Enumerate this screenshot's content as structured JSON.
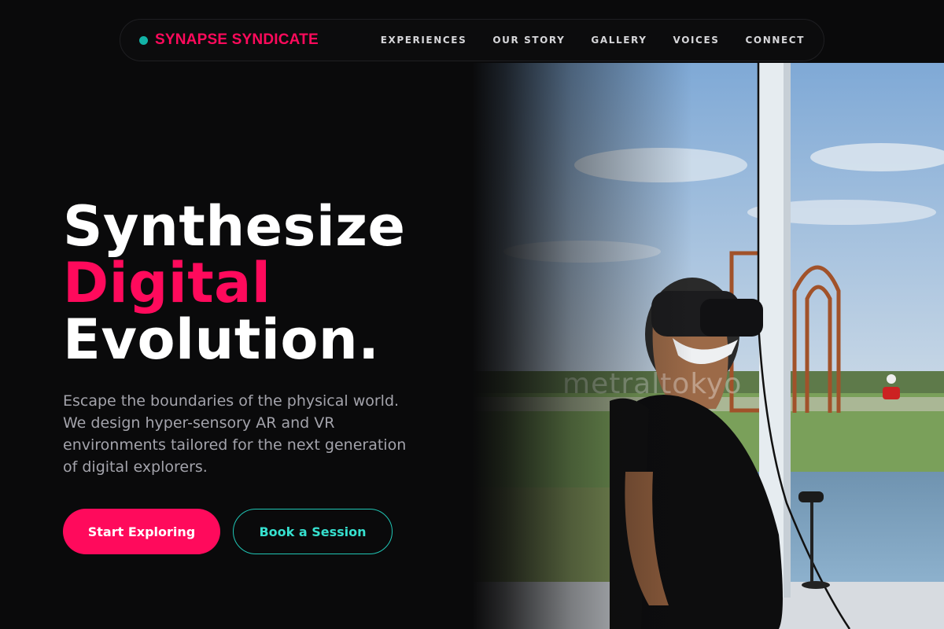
{
  "brand": {
    "name": "SYNAPSE SYNDICATE",
    "dot_color": "#12b3a6",
    "accent_color": "#ff0a5c"
  },
  "nav": {
    "items": [
      {
        "label": "EXPERIENCES"
      },
      {
        "label": "OUR STORY"
      },
      {
        "label": "GALLERY"
      },
      {
        "label": "VOICES"
      },
      {
        "label": "CONNECT"
      }
    ]
  },
  "hero": {
    "headline_line1": "Synthesize",
    "headline_line2": "Digital",
    "headline_line3": "Evolution.",
    "subtext": "Escape the boundaries of the physical world. We design hyper-sensory AR and VR environments tailored for the next generation of digital explorers.",
    "primary_button": "Start Exploring",
    "secondary_button": "Book a Session",
    "secondary_color": "#20c5b5"
  },
  "image": {
    "watermark": "metraltokyo"
  }
}
